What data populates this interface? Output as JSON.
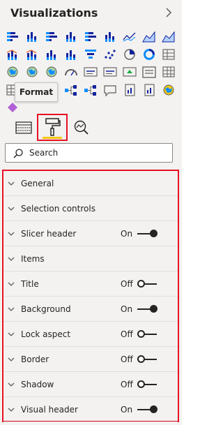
{
  "header": {
    "title": "Visualizations"
  },
  "tooltip": {
    "text": "Format"
  },
  "search": {
    "placeholder": "Search"
  },
  "colors": {
    "accent_red": "#e81123",
    "accent_yellow": "#f2c811",
    "text": "#252423",
    "panel_bg": "#f3f2f1"
  },
  "gallery": {
    "icons": [
      "stacked-bar-chart-icon",
      "stacked-column-chart-icon",
      "clustered-bar-chart-icon",
      "clustered-column-chart-icon",
      "percent-stacked-bar-chart-icon",
      "percent-stacked-column-chart-icon",
      "line-chart-icon",
      "area-chart-icon",
      "stacked-area-chart-icon",
      "line-stacked-column-chart-icon",
      "line-clustered-column-chart-icon",
      "ribbon-chart-icon",
      "waterfall-chart-icon",
      "funnel-chart-icon",
      "scatter-chart-icon",
      "pie-chart-icon",
      "donut-chart-icon",
      "treemap-icon",
      "map-icon",
      "filled-map-icon",
      "shape-map-icon",
      "gauge-icon",
      "card-icon",
      "multi-row-card-icon",
      "kpi-icon",
      "slicer-icon",
      "table-icon",
      "matrix-icon",
      "r-script-visual-icon",
      "python-visual-icon",
      "key-influencers-icon",
      "decomposition-tree-icon",
      "qa-icon",
      "smart-narrative-icon",
      "paginated-report-icon",
      "arcgis-map-icon",
      "power-apps-icon"
    ]
  },
  "tabs": {
    "fields": {
      "icon": "fields-grid-icon"
    },
    "format": {
      "icon": "paint-roller-icon"
    },
    "analytics": {
      "icon": "analytics-magnifier-icon"
    }
  },
  "sections": [
    {
      "label": "General",
      "toggle": null
    },
    {
      "label": "Selection controls",
      "toggle": null
    },
    {
      "label": "Slicer header",
      "toggle": "On"
    },
    {
      "label": "Items",
      "toggle": null
    },
    {
      "label": "Title",
      "toggle": "Off"
    },
    {
      "label": "Background",
      "toggle": "On"
    },
    {
      "label": "Lock aspect",
      "toggle": "Off"
    },
    {
      "label": "Border",
      "toggle": "Off"
    },
    {
      "label": "Shadow",
      "toggle": "Off"
    },
    {
      "label": "Visual header",
      "toggle": "On"
    }
  ]
}
